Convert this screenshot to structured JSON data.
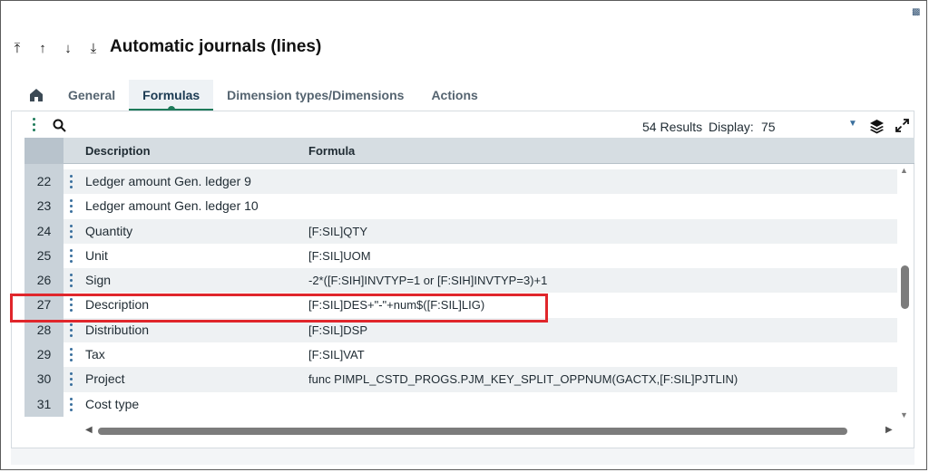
{
  "header": {
    "title": "Automatic journals (lines)",
    "nav_icons": [
      "first-record-icon",
      "previous-record-icon",
      "next-record-icon",
      "last-record-icon"
    ]
  },
  "tabs": [
    {
      "label": "General"
    },
    {
      "label": "Formulas",
      "active": true
    },
    {
      "label": "Dimension types/Dimensions"
    },
    {
      "label": "Actions"
    }
  ],
  "toolbar": {
    "results": "54 Results",
    "display_label": "Display:",
    "display_value": "75"
  },
  "grid": {
    "columns": {
      "description": "Description",
      "formula": "Formula"
    },
    "rows": [
      {
        "num": "22",
        "description": "Ledger amount Gen. ledger 9",
        "formula": ""
      },
      {
        "num": "23",
        "description": "Ledger amount Gen. ledger 10",
        "formula": ""
      },
      {
        "num": "24",
        "description": "Quantity",
        "formula": "[F:SIL]QTY"
      },
      {
        "num": "25",
        "description": "Unit",
        "formula": "[F:SIL]UOM"
      },
      {
        "num": "26",
        "description": "Sign",
        "formula": "-2*([F:SIH]INVTYP=1 or [F:SIH]INVTYP=3)+1"
      },
      {
        "num": "27",
        "description": "Description",
        "formula": "[F:SIL]DES+\"-\"+num$([F:SIL]LIG)"
      },
      {
        "num": "28",
        "description": "Distribution",
        "formula": "[F:SIL]DSP"
      },
      {
        "num": "29",
        "description": "Tax",
        "formula": "[F:SIL]VAT"
      },
      {
        "num": "30",
        "description": "Project",
        "formula": "func PIMPL_CSTD_PROGS.PJM_KEY_SPLIT_OPPNUM(GACTX,[F:SIL]PJTLIN)"
      },
      {
        "num": "31",
        "description": "Cost type",
        "formula": ""
      }
    ]
  },
  "colors": {
    "accent": "#1e7a5a",
    "highlight": "#e0262b",
    "header_bg": "#d6dde2"
  }
}
